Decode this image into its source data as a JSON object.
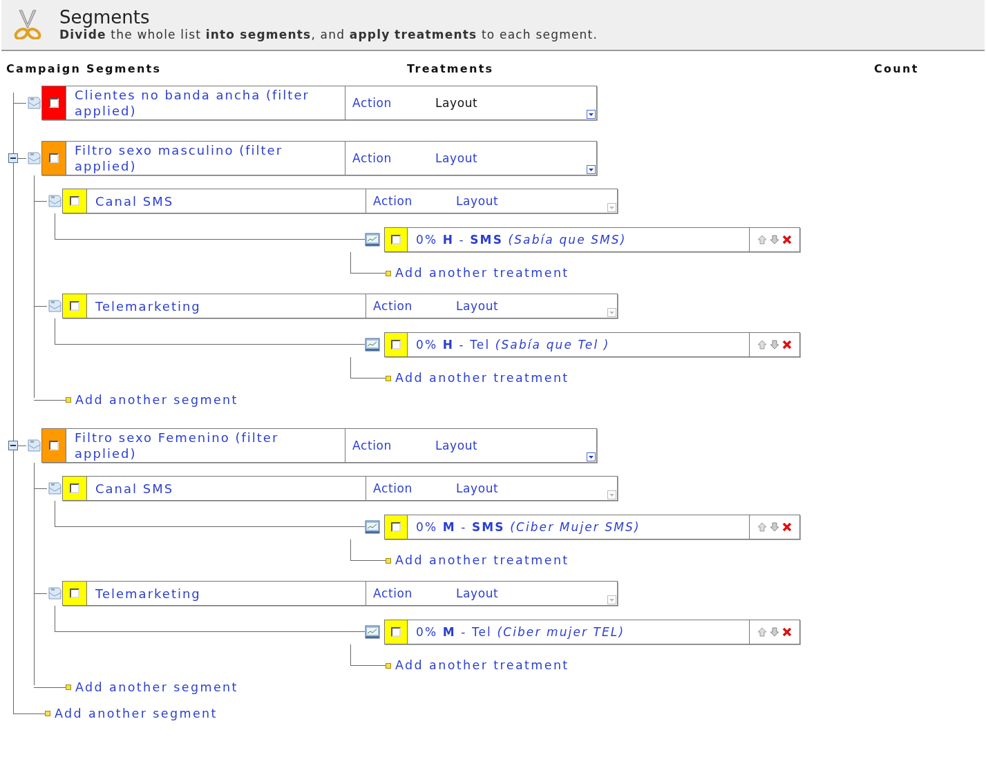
{
  "header": {
    "title": "Segments",
    "subtitle": "**Divide** the whole list **into segments**, and **apply**  **treatments** to each segment."
  },
  "columns": [
    "Campaign Segments",
    "Treatments",
    "Count"
  ],
  "segments": [
    {
      "name": "Clientes no banda ancha (filter applied)",
      "color": "#ff0000",
      "checked": false,
      "action": "Action",
      "layout": "Layout",
      "layout_active": false,
      "menu_enabled": true
    },
    {
      "name": "Filtro sexo masculino (filter applied)",
      "color": "#ff9900",
      "checked": false,
      "action": "Action",
      "layout": "Layout",
      "layout_active": true,
      "menu_enabled": true,
      "expanded": true,
      "children": [
        {
          "name": "Canal SMS",
          "color": "#ffff00",
          "checked": false,
          "action": "Action",
          "layout": "Layout",
          "layout_active": true,
          "menu_enabled": false,
          "treatments": [
            {
              "label": "0% **H** - **SMS** *(Sabía que SMS)*",
              "color": "#ffff00",
              "checked": false
            }
          ],
          "add_treatment": "Add another treatment"
        },
        {
          "name": "Telemarketing",
          "color": "#ffff00",
          "checked": false,
          "action": "Action",
          "layout": "Layout",
          "layout_active": true,
          "menu_enabled": false,
          "treatments": [
            {
              "label": "0% **H** - Tel  *(Sabía que Tel )*",
              "color": "#ffff00",
              "checked": false
            }
          ],
          "add_treatment": "Add another treatment"
        }
      ],
      "add_segment": "Add another segment"
    },
    {
      "name": "Filtro sexo Femenino (filter applied)",
      "color": "#ff9900",
      "checked": false,
      "action": "Action",
      "layout": "Layout",
      "layout_active": true,
      "menu_enabled": true,
      "expanded": true,
      "children": [
        {
          "name": "Canal SMS",
          "color": "#ffff00",
          "checked": false,
          "action": "Action",
          "layout": "Layout",
          "layout_active": true,
          "menu_enabled": false,
          "treatments": [
            {
              "label": "0% **M** - **SMS** *(Ciber Mujer SMS)*",
              "color": "#ffff00",
              "checked": false
            }
          ],
          "add_treatment": "Add another treatment"
        },
        {
          "name": "Telemarketing",
          "color": "#ffff00",
          "checked": false,
          "action": "Action",
          "layout": "Layout",
          "layout_active": true,
          "menu_enabled": false,
          "treatments": [
            {
              "label": "0% **M** - Tel  *(Ciber mujer TEL)*",
              "color": "#ffff00",
              "checked": false
            }
          ],
          "add_treatment": "Add another treatment"
        }
      ],
      "add_segment": "Add another segment"
    }
  ],
  "add_segment": "Add another segment"
}
